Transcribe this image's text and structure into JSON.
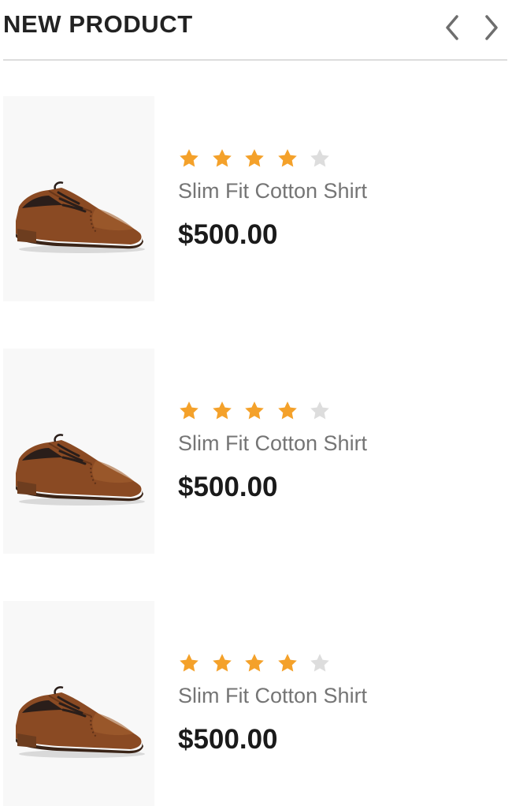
{
  "widget": {
    "title": "NEW PRODUCT",
    "prev_icon": "chevron-left-icon",
    "next_icon": "chevron-right-icon"
  },
  "colors": {
    "star_filled": "#F4A12A",
    "star_empty": "#DDDDDD",
    "price": "#1A1A1A",
    "name": "#757575",
    "divider": "#DDDDDD"
  },
  "products": [
    {
      "name": "Slim Fit Cotton Shirt",
      "price": "$500.00",
      "rating": 4,
      "rating_max": 5,
      "image_icon": "brown-oxford-shoe-image"
    },
    {
      "name": "Slim Fit Cotton Shirt",
      "price": "$500.00",
      "rating": 4,
      "rating_max": 5,
      "image_icon": "brown-oxford-shoe-image"
    },
    {
      "name": "Slim Fit Cotton Shirt",
      "price": "$500.00",
      "rating": 4,
      "rating_max": 5,
      "image_icon": "brown-oxford-shoe-image"
    }
  ]
}
